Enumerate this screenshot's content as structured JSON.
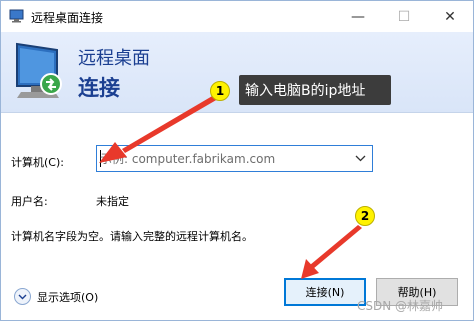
{
  "window": {
    "title": "远程桌面连接",
    "controls": {
      "minimize": "—",
      "maximize": "☐",
      "close": "✕"
    }
  },
  "banner": {
    "line1": "远程桌面",
    "line2": "连接"
  },
  "annotations": {
    "badge1": "1",
    "badge2": "2",
    "callout": "输入电脑B的ip地址",
    "arrow_color": "#e8392b"
  },
  "form": {
    "computer_label": "计算机(C):",
    "computer_placeholder": "示例: computer.fabrikam.com",
    "computer_value": "",
    "user_label": "用户名:",
    "user_value": "未指定",
    "message": "计算机名字段为空。请输入完整的远程计算机名。"
  },
  "footer": {
    "show_options": "显示选项(O)",
    "connect": "连接(N)",
    "help": "帮助(H)"
  },
  "watermark": "CSDN @林嘉帅",
  "colors": {
    "banner_text": "#1b3f91",
    "focus_border": "#2f7ed8",
    "primary_border": "#0078d7",
    "badge": "#fff200",
    "callout_bg": "#3c3c3c"
  }
}
